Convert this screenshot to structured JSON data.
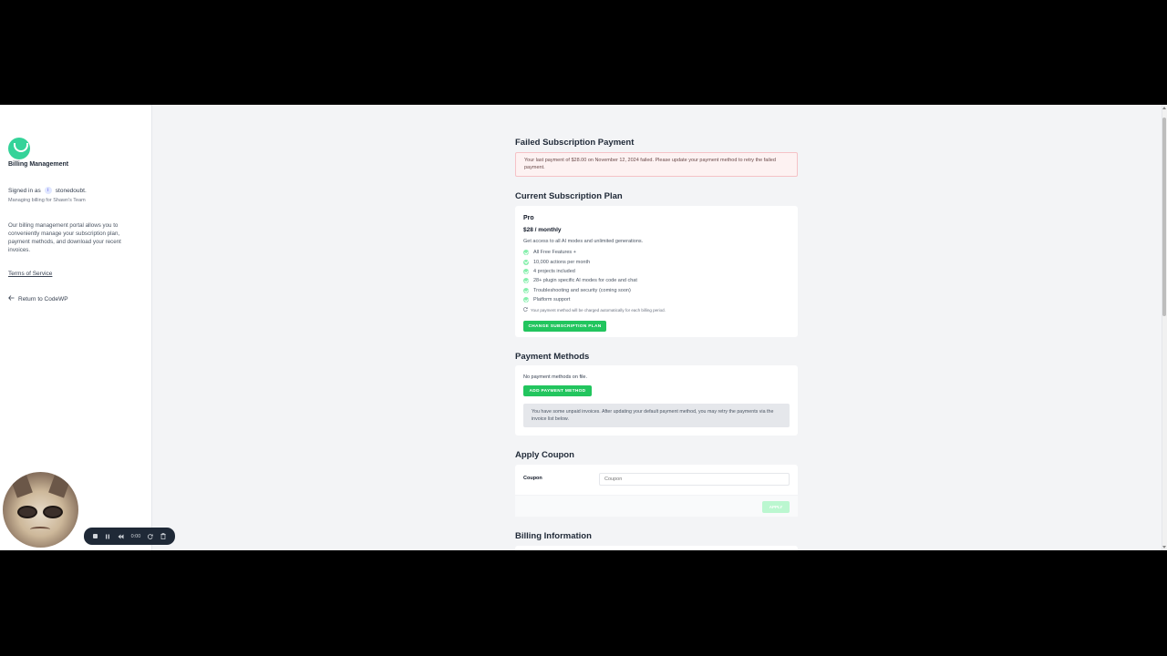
{
  "sidebar": {
    "title": "Billing Management",
    "signed_in_prefix": "Signed in as",
    "username": "stonedoubt.",
    "team_line": "Managing billing for Shawn's Team",
    "description": "Our billing management portal allows you to conveniently manage your subscription plan, payment methods, and download your recent invoices.",
    "terms_label": "Terms of Service",
    "return_label": "Return to CodeWP"
  },
  "failed_payment": {
    "heading": "Failed Subscription Payment",
    "message": "Your last payment of $28.00 on November 12, 2024 failed. Please update your payment method to retry the failed payment."
  },
  "subscription": {
    "heading": "Current Subscription Plan",
    "plan_name": "Pro",
    "price": "$28 / monthly",
    "description": "Get access to all AI modes and unlimited generations.",
    "features": [
      "All Free Features +",
      "10,000 actions per month",
      "4 projects included",
      "28+ plugin specific AI modes for code and chat",
      "Troubleshooting and security (coming soon)",
      "Platform support"
    ],
    "auto_charge_note": "Your payment method will be charged automatically for each billing period.",
    "change_button": "CHANGE SUBSCRIPTION PLAN"
  },
  "payment_methods": {
    "heading": "Payment Methods",
    "empty_text": "No payment methods on file.",
    "add_button": "ADD PAYMENT METHOD",
    "unpaid_notice": "You have some unpaid invoices. After updating your default payment method, you may retry the payments via the invoice list below."
  },
  "coupon": {
    "heading": "Apply Coupon",
    "label": "Coupon",
    "placeholder": "Coupon",
    "apply_button": "APPLY"
  },
  "billing_info": {
    "heading": "Billing Information"
  },
  "recorder": {
    "time": "0:00"
  },
  "colors": {
    "accent_green": "#22c55e",
    "alert_bg": "#fdf2f2",
    "page_bg": "#f3f4f6"
  }
}
